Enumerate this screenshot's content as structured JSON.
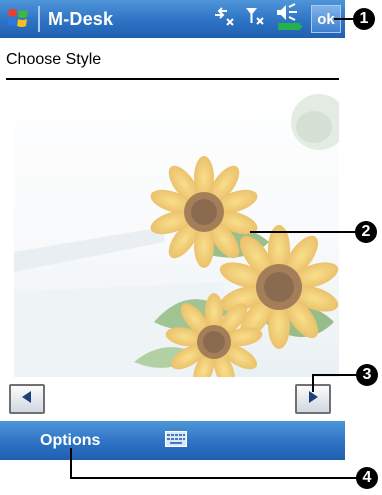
{
  "titlebar": {
    "title": "M-Desk",
    "ok_label": "ok"
  },
  "heading": {
    "text": "Choose Style"
  },
  "menubar": {
    "options_label": "Options"
  },
  "callouts": [
    "1",
    "2",
    "3",
    "4"
  ],
  "colors": {
    "bar_blue": "#2e73c4",
    "battery_green": "#22b14c"
  },
  "icons": [
    "windows-start-icon",
    "connectivity-icon",
    "signal-off-icon",
    "speaker-icon",
    "battery-icon",
    "left-arrow-icon",
    "right-arrow-icon",
    "keyboard-icon"
  ]
}
